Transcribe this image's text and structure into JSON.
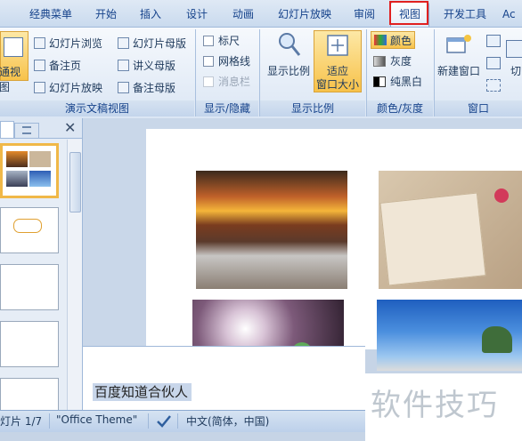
{
  "tabs": [
    {
      "label": "经典菜单"
    },
    {
      "label": "开始"
    },
    {
      "label": "插入"
    },
    {
      "label": "设计"
    },
    {
      "label": "动画"
    },
    {
      "label": "幻灯片放映"
    },
    {
      "label": "审阅"
    },
    {
      "label": "视图"
    },
    {
      "label": "开发工具"
    },
    {
      "label": "Ac"
    }
  ],
  "ribbon": {
    "presentation_views": {
      "normal_label": "通视图",
      "slide_sorter": "幻灯片浏览",
      "notes_page": "备注页",
      "reading_view": "幻灯片放映",
      "slide_master": "幻灯片母版",
      "handout_master": "讲义母版",
      "notes_master": "备注母版",
      "group_label": "演示文稿视图"
    },
    "show_hide": {
      "ruler": "标尺",
      "gridlines": "网格线",
      "message_bar": "消息栏",
      "group_label": "显示/隐藏"
    },
    "zoom": {
      "zoom_label": "显示比例",
      "fit_line1": "适应",
      "fit_line2": "窗口大小",
      "group_label": "显示比例"
    },
    "color": {
      "color": "颜色",
      "grayscale": "灰度",
      "black_white": "纯黑白",
      "group_label": "颜色/灰度"
    },
    "window": {
      "new_window": "新建窗口",
      "switch_partial": "切",
      "group_label": "窗口"
    }
  },
  "notes": {
    "text": "百度知道合伙人"
  },
  "watermark": {
    "text": "软件技巧"
  },
  "status": {
    "slide": "灯片 1/7",
    "theme": "\"Office Theme\"",
    "language": "中文(简体，中国)"
  },
  "colors": {
    "accent_red": "#e02020",
    "tab_active": "#ffffff",
    "ribbon_bg": "#dbe6f4"
  }
}
